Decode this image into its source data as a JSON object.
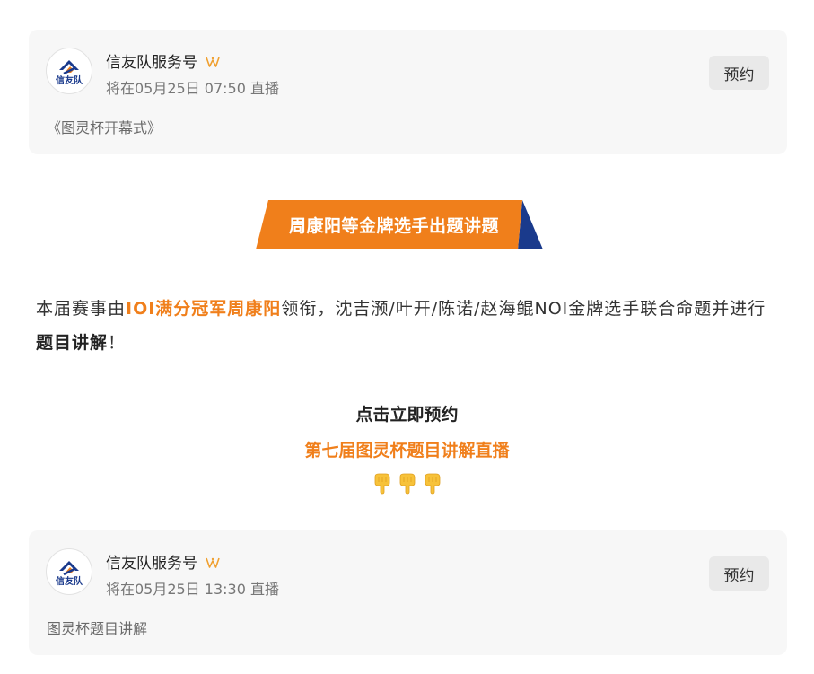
{
  "cards": [
    {
      "account_name": "信友队服务号",
      "logo_text": "信友队",
      "schedule": "将在05月25日 07:50 直播",
      "reserve_label": "预约",
      "live_title": "《图灵杯开幕式》"
    },
    {
      "account_name": "信友队服务号",
      "logo_text": "信友队",
      "schedule": "将在05月25日 13:30 直播",
      "reserve_label": "预约",
      "live_title": "图灵杯题目讲解"
    }
  ],
  "banner": {
    "text": "周康阳等金牌选手出题讲题"
  },
  "intro": {
    "part1": "本届赛事由",
    "highlight": "IOI满分冠军周康阳",
    "part2": "领衔，沈吉滪/叶开/陈诺/赵海鲲NOI金牌选手联合命题并进行",
    "bold": "题目讲解",
    "part3": "！"
  },
  "cta": {
    "line1": "点击立即预约",
    "line2": "第七届图灵杯题目讲解直播",
    "pointer_icon": "pointing-down-hand-icon",
    "pointer_count": 3
  },
  "colors": {
    "accent_orange": "#f07f1b",
    "banner_navy": "#1a3a8c",
    "verified_gold": "#f0a030"
  }
}
